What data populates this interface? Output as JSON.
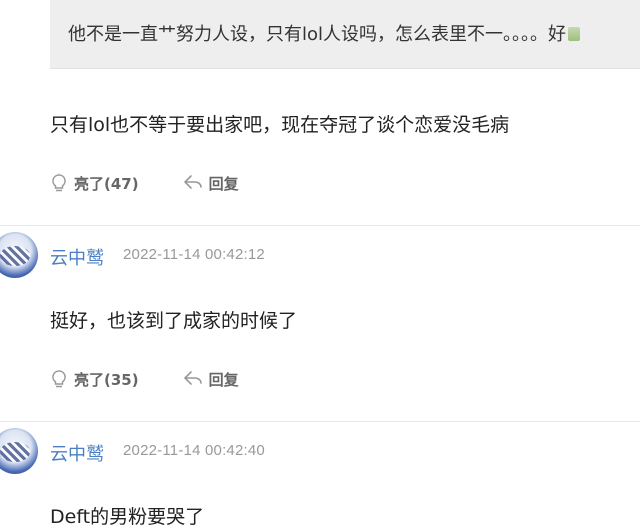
{
  "quote": {
    "text": "他不是一直艹努力人设，只有lol人设吗，怎么表里不一。。。。好"
  },
  "reply": {
    "text": "只有lol也不等于要出家吧，现在夺冠了谈个恋爱没毛病",
    "like_label": "亮了(47)",
    "reply_label": "回复"
  },
  "comments": [
    {
      "username": "云中鹫",
      "time": "2022-11-14 00:42:12",
      "text": "挺好，也该到了成家的时候了",
      "like_label": "亮了(35)",
      "reply_label": "回复"
    },
    {
      "username": "云中鹫",
      "time": "2022-11-14 00:42:40",
      "text": "Deft的男粉要哭了"
    }
  ]
}
